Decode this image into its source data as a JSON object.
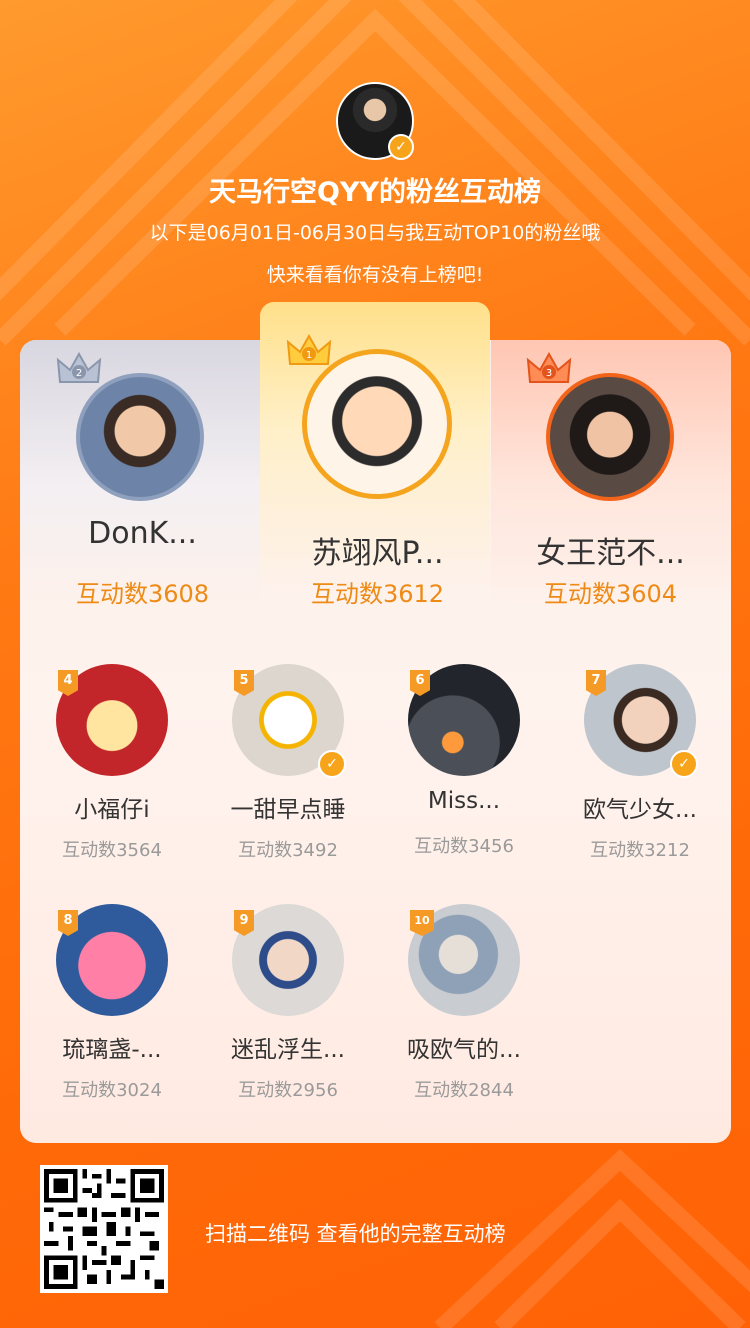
{
  "header": {
    "title": "天马行空QYY的粉丝互动榜",
    "subtitle_line1": "以下是06月01日-06月30日与我互动TOP10的粉丝哦",
    "subtitle_line2": "快来看看你有没有上榜吧!",
    "host_badge_icon": "v-badge-icon"
  },
  "top3": [
    {
      "rank": "2",
      "name": "DonK...",
      "count_label": "互动数3608"
    },
    {
      "rank": "1",
      "name": "苏翊风P...",
      "count_label": "互动数3612"
    },
    {
      "rank": "3",
      "name": "女王范不...",
      "count_label": "互动数3604"
    }
  ],
  "fans": [
    {
      "rank": "4",
      "name": "小福仔i",
      "count_label": "互动数3564",
      "verified": false
    },
    {
      "rank": "5",
      "name": "一甜早点睡",
      "count_label": "互动数3492",
      "verified": true
    },
    {
      "rank": "6",
      "name": "Miss...",
      "count_label": "互动数3456",
      "verified": false
    },
    {
      "rank": "7",
      "name": "欧气少女...",
      "count_label": "互动数3212",
      "verified": true
    },
    {
      "rank": "8",
      "name": "琉璃盏-...",
      "count_label": "互动数3024",
      "verified": false
    },
    {
      "rank": "9",
      "name": "迷乱浮生...",
      "count_label": "互动数2956",
      "verified": false
    },
    {
      "rank": "10",
      "name": "吸欧气的...",
      "count_label": "互动数2844",
      "verified": false
    }
  ],
  "footer": {
    "qr_caption": "扫描二维码 查看他的完整互动榜"
  },
  "colors": {
    "background": "#ff7a14",
    "accent_count": "#ee8a16",
    "badge": "#f7a41a"
  }
}
